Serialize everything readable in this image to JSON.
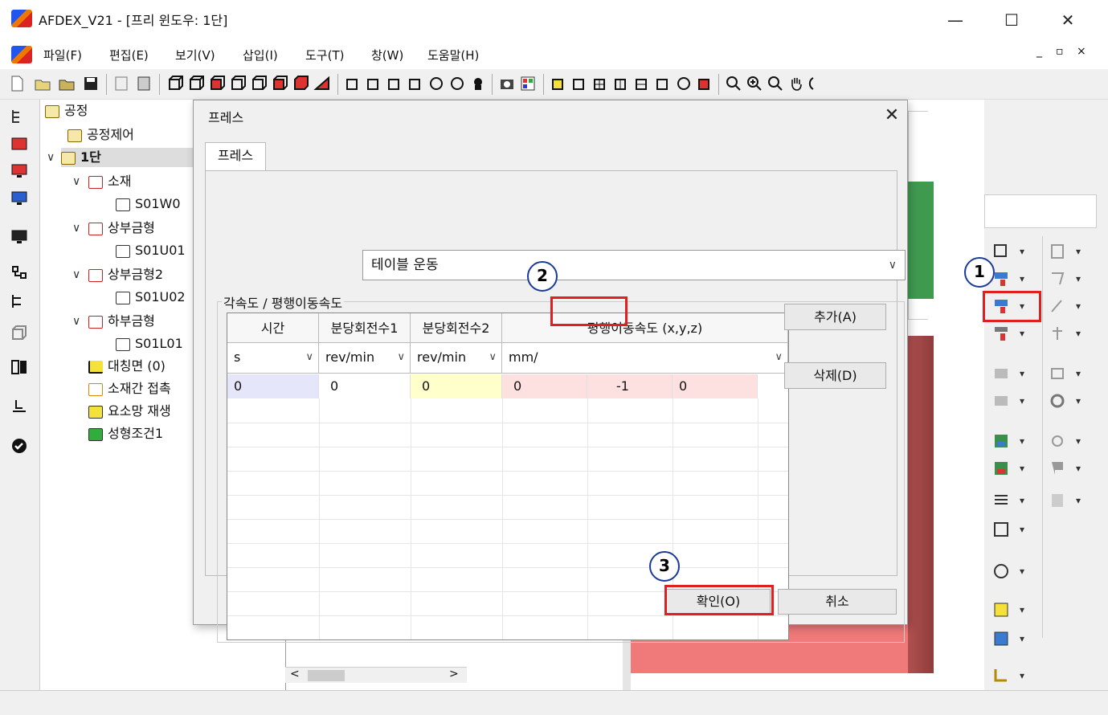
{
  "window": {
    "title": "AFDEX_V21 - [프리 윈도우: 1단]",
    "minimize": "—",
    "maximize": "☐",
    "close": "✕"
  },
  "menu": [
    {
      "label": "파일(F)"
    },
    {
      "label": "편집(E)"
    },
    {
      "label": "보기(V)"
    },
    {
      "label": "삽입(I)"
    },
    {
      "label": "도구(T)"
    },
    {
      "label": "창(W)"
    },
    {
      "label": "도움말(H)"
    }
  ],
  "mdi_controls": [
    "_",
    "▫",
    "×"
  ],
  "tree": {
    "root": "공정",
    "items": [
      {
        "label": "공정제어"
      },
      {
        "label": "1단"
      },
      {
        "label": "소재"
      },
      {
        "label": "S01W0"
      },
      {
        "label": "상부금형"
      },
      {
        "label": "S01U01"
      },
      {
        "label": "상부금형2"
      },
      {
        "label": "S01U02"
      },
      {
        "label": "하부금형"
      },
      {
        "label": "S01L01"
      },
      {
        "label": "대칭면 (0)"
      },
      {
        "label": "소재간 접촉"
      },
      {
        "label": "요소망 재생"
      },
      {
        "label": "성형조건1"
      }
    ]
  },
  "scrollbar": {
    "left": "<",
    "right": ">"
  },
  "dialog": {
    "title": "프레스",
    "close": "✕",
    "tab": "프레스",
    "mode_select": "테이블 운동",
    "group_label": "각속도 / 평행이동속도",
    "columns": [
      "시간",
      "분당회전수1",
      "분당회전수2",
      "평행이동속도 (x,y,z)"
    ],
    "units": [
      "s",
      "rev/min",
      "rev/min",
      "mm/"
    ],
    "row": [
      "0",
      "0",
      "0",
      "0",
      "-1",
      "0"
    ],
    "add_button": "추가(A)",
    "delete_button": "삭제(D)",
    "ok_button": "확인(O)",
    "cancel_button": "취소"
  },
  "callouts": [
    "1",
    "2",
    "3"
  ],
  "colors": {
    "highlight_red": "#e02020",
    "badge_border": "#1a3a9c",
    "green_object": "#3f9a50",
    "red_object": "#f07a7a"
  }
}
